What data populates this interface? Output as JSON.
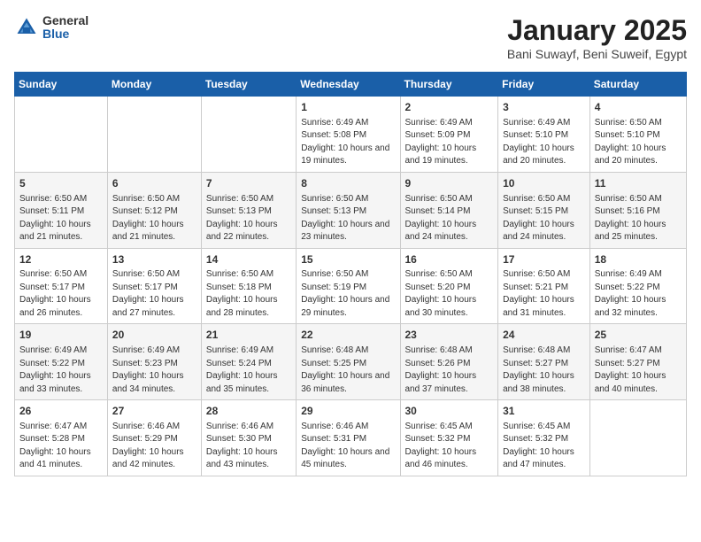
{
  "logo": {
    "general": "General",
    "blue": "Blue"
  },
  "title": "January 2025",
  "subtitle": "Bani Suwayf, Beni Suweif, Egypt",
  "weekdays": [
    "Sunday",
    "Monday",
    "Tuesday",
    "Wednesday",
    "Thursday",
    "Friday",
    "Saturday"
  ],
  "weeks": [
    [
      {
        "day": "",
        "sunrise": "",
        "sunset": "",
        "daylight": ""
      },
      {
        "day": "",
        "sunrise": "",
        "sunset": "",
        "daylight": ""
      },
      {
        "day": "",
        "sunrise": "",
        "sunset": "",
        "daylight": ""
      },
      {
        "day": "1",
        "sunrise": "Sunrise: 6:49 AM",
        "sunset": "Sunset: 5:08 PM",
        "daylight": "Daylight: 10 hours and 19 minutes."
      },
      {
        "day": "2",
        "sunrise": "Sunrise: 6:49 AM",
        "sunset": "Sunset: 5:09 PM",
        "daylight": "Daylight: 10 hours and 19 minutes."
      },
      {
        "day": "3",
        "sunrise": "Sunrise: 6:49 AM",
        "sunset": "Sunset: 5:10 PM",
        "daylight": "Daylight: 10 hours and 20 minutes."
      },
      {
        "day": "4",
        "sunrise": "Sunrise: 6:50 AM",
        "sunset": "Sunset: 5:10 PM",
        "daylight": "Daylight: 10 hours and 20 minutes."
      }
    ],
    [
      {
        "day": "5",
        "sunrise": "Sunrise: 6:50 AM",
        "sunset": "Sunset: 5:11 PM",
        "daylight": "Daylight: 10 hours and 21 minutes."
      },
      {
        "day": "6",
        "sunrise": "Sunrise: 6:50 AM",
        "sunset": "Sunset: 5:12 PM",
        "daylight": "Daylight: 10 hours and 21 minutes."
      },
      {
        "day": "7",
        "sunrise": "Sunrise: 6:50 AM",
        "sunset": "Sunset: 5:13 PM",
        "daylight": "Daylight: 10 hours and 22 minutes."
      },
      {
        "day": "8",
        "sunrise": "Sunrise: 6:50 AM",
        "sunset": "Sunset: 5:13 PM",
        "daylight": "Daylight: 10 hours and 23 minutes."
      },
      {
        "day": "9",
        "sunrise": "Sunrise: 6:50 AM",
        "sunset": "Sunset: 5:14 PM",
        "daylight": "Daylight: 10 hours and 24 minutes."
      },
      {
        "day": "10",
        "sunrise": "Sunrise: 6:50 AM",
        "sunset": "Sunset: 5:15 PM",
        "daylight": "Daylight: 10 hours and 24 minutes."
      },
      {
        "day": "11",
        "sunrise": "Sunrise: 6:50 AM",
        "sunset": "Sunset: 5:16 PM",
        "daylight": "Daylight: 10 hours and 25 minutes."
      }
    ],
    [
      {
        "day": "12",
        "sunrise": "Sunrise: 6:50 AM",
        "sunset": "Sunset: 5:17 PM",
        "daylight": "Daylight: 10 hours and 26 minutes."
      },
      {
        "day": "13",
        "sunrise": "Sunrise: 6:50 AM",
        "sunset": "Sunset: 5:17 PM",
        "daylight": "Daylight: 10 hours and 27 minutes."
      },
      {
        "day": "14",
        "sunrise": "Sunrise: 6:50 AM",
        "sunset": "Sunset: 5:18 PM",
        "daylight": "Daylight: 10 hours and 28 minutes."
      },
      {
        "day": "15",
        "sunrise": "Sunrise: 6:50 AM",
        "sunset": "Sunset: 5:19 PM",
        "daylight": "Daylight: 10 hours and 29 minutes."
      },
      {
        "day": "16",
        "sunrise": "Sunrise: 6:50 AM",
        "sunset": "Sunset: 5:20 PM",
        "daylight": "Daylight: 10 hours and 30 minutes."
      },
      {
        "day": "17",
        "sunrise": "Sunrise: 6:50 AM",
        "sunset": "Sunset: 5:21 PM",
        "daylight": "Daylight: 10 hours and 31 minutes."
      },
      {
        "day": "18",
        "sunrise": "Sunrise: 6:49 AM",
        "sunset": "Sunset: 5:22 PM",
        "daylight": "Daylight: 10 hours and 32 minutes."
      }
    ],
    [
      {
        "day": "19",
        "sunrise": "Sunrise: 6:49 AM",
        "sunset": "Sunset: 5:22 PM",
        "daylight": "Daylight: 10 hours and 33 minutes."
      },
      {
        "day": "20",
        "sunrise": "Sunrise: 6:49 AM",
        "sunset": "Sunset: 5:23 PM",
        "daylight": "Daylight: 10 hours and 34 minutes."
      },
      {
        "day": "21",
        "sunrise": "Sunrise: 6:49 AM",
        "sunset": "Sunset: 5:24 PM",
        "daylight": "Daylight: 10 hours and 35 minutes."
      },
      {
        "day": "22",
        "sunrise": "Sunrise: 6:48 AM",
        "sunset": "Sunset: 5:25 PM",
        "daylight": "Daylight: 10 hours and 36 minutes."
      },
      {
        "day": "23",
        "sunrise": "Sunrise: 6:48 AM",
        "sunset": "Sunset: 5:26 PM",
        "daylight": "Daylight: 10 hours and 37 minutes."
      },
      {
        "day": "24",
        "sunrise": "Sunrise: 6:48 AM",
        "sunset": "Sunset: 5:27 PM",
        "daylight": "Daylight: 10 hours and 38 minutes."
      },
      {
        "day": "25",
        "sunrise": "Sunrise: 6:47 AM",
        "sunset": "Sunset: 5:27 PM",
        "daylight": "Daylight: 10 hours and 40 minutes."
      }
    ],
    [
      {
        "day": "26",
        "sunrise": "Sunrise: 6:47 AM",
        "sunset": "Sunset: 5:28 PM",
        "daylight": "Daylight: 10 hours and 41 minutes."
      },
      {
        "day": "27",
        "sunrise": "Sunrise: 6:46 AM",
        "sunset": "Sunset: 5:29 PM",
        "daylight": "Daylight: 10 hours and 42 minutes."
      },
      {
        "day": "28",
        "sunrise": "Sunrise: 6:46 AM",
        "sunset": "Sunset: 5:30 PM",
        "daylight": "Daylight: 10 hours and 43 minutes."
      },
      {
        "day": "29",
        "sunrise": "Sunrise: 6:46 AM",
        "sunset": "Sunset: 5:31 PM",
        "daylight": "Daylight: 10 hours and 45 minutes."
      },
      {
        "day": "30",
        "sunrise": "Sunrise: 6:45 AM",
        "sunset": "Sunset: 5:32 PM",
        "daylight": "Daylight: 10 hours and 46 minutes."
      },
      {
        "day": "31",
        "sunrise": "Sunrise: 6:45 AM",
        "sunset": "Sunset: 5:32 PM",
        "daylight": "Daylight: 10 hours and 47 minutes."
      },
      {
        "day": "",
        "sunrise": "",
        "sunset": "",
        "daylight": ""
      }
    ]
  ]
}
